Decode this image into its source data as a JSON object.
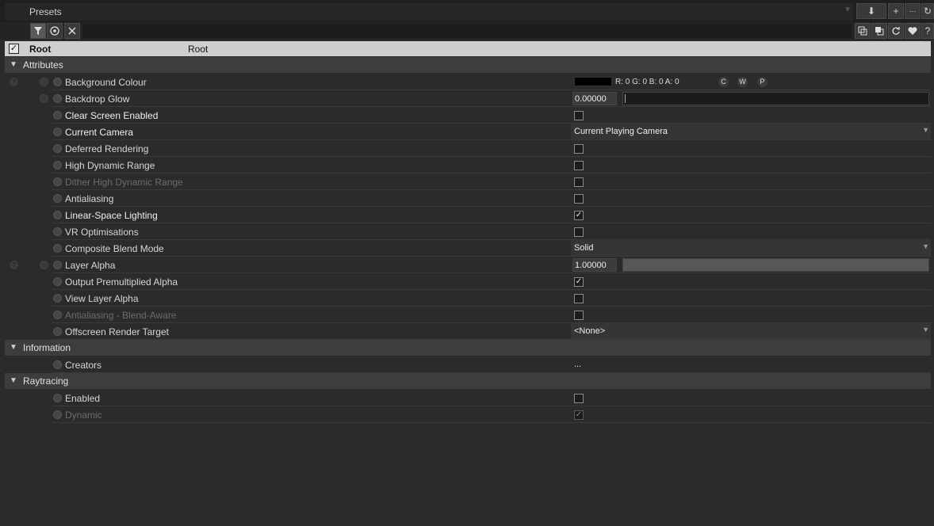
{
  "presets": {
    "title": "Presets",
    "buttons": {
      "download": "⬇",
      "add": "+",
      "more": "···",
      "refresh": "↻"
    }
  },
  "filter": {
    "filter_icon": "funnel-icon",
    "target_icon": "target-icon",
    "clear_icon": "x-icon"
  },
  "right_tools": [
    "copy-icon",
    "paste-icon",
    "reset-icon",
    "favorite-icon",
    "help-icon"
  ],
  "root": {
    "checked": "✓",
    "name": "Root",
    "value": "Root"
  },
  "sections": {
    "attributes": "Attributes",
    "information": "Information",
    "raytracing": "Raytracing"
  },
  "attributes": {
    "background_colour": {
      "label": "Background Colour",
      "rgba": "R: 0 G: 0 B: 0 A: 0",
      "c": "C",
      "w": "W",
      "p": "P"
    },
    "backdrop_glow": {
      "label": "Backdrop Glow",
      "value": "0.00000"
    },
    "clear_screen": {
      "label": "Clear Screen Enabled",
      "checked": ""
    },
    "current_camera": {
      "label": "Current Camera",
      "value": "Current Playing Camera"
    },
    "deferred_rendering": {
      "label": "Deferred Rendering",
      "checked": ""
    },
    "high_dynamic_range": {
      "label": "High Dynamic Range",
      "checked": ""
    },
    "dither_hdr": {
      "label": "Dither High Dynamic Range",
      "checked": ""
    },
    "antialiasing": {
      "label": "Antialiasing",
      "checked": ""
    },
    "linear_space": {
      "label": "Linear-Space Lighting",
      "checked": "✓"
    },
    "vr_opt": {
      "label": "VR Optimisations",
      "checked": ""
    },
    "composite_blend": {
      "label": "Composite Blend Mode",
      "value": "Solid"
    },
    "layer_alpha": {
      "label": "Layer Alpha",
      "value": "1.00000",
      "fraction": 1.0
    },
    "output_premult": {
      "label": "Output Premultiplied Alpha",
      "checked": "✓"
    },
    "view_layer_alpha": {
      "label": "View Layer Alpha",
      "checked": ""
    },
    "aa_blend_aware": {
      "label": "Antialiasing - Blend-Aware",
      "checked": ""
    },
    "offscreen_target": {
      "label": "Offscreen Render Target",
      "value": "<None>"
    }
  },
  "information": {
    "creators": {
      "label": "Creators",
      "value": "..."
    }
  },
  "raytracing": {
    "enabled": {
      "label": "Enabled",
      "checked": ""
    },
    "dynamic": {
      "label": "Dynamic",
      "checked": "✓"
    }
  },
  "select_arrow": "▼",
  "section_arrow": "▼",
  "help_glyph": "?"
}
